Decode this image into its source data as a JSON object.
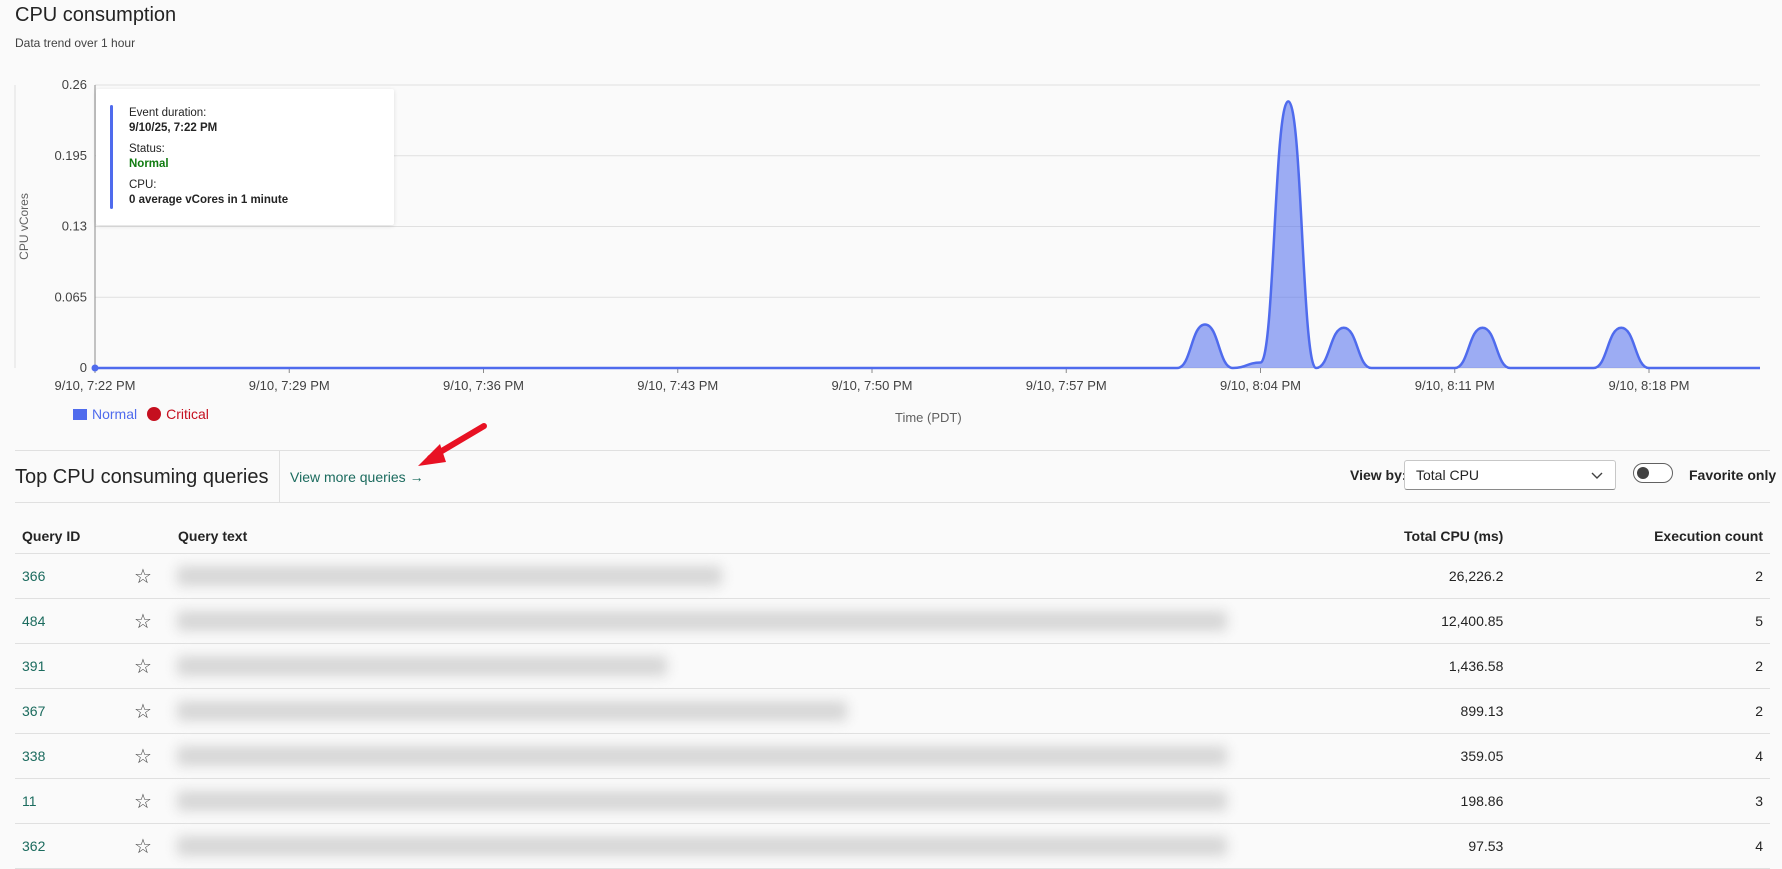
{
  "header": {
    "title": "CPU consumption",
    "subtitle": "Data trend over 1 hour"
  },
  "chart_data": {
    "type": "area",
    "ylabel": "CPU vCores",
    "xlabel": "Time (PDT)",
    "ylim": [
      0,
      0.26
    ],
    "yticks": [
      "0.26",
      "0.195",
      "0.13",
      "0.065",
      "0"
    ],
    "xticks": [
      "9/10, 7:22 PM",
      "9/10, 7:29 PM",
      "9/10, 7:36 PM",
      "9/10, 7:43 PM",
      "9/10, 7:50 PM",
      "9/10, 7:57 PM",
      "9/10, 8:04 PM",
      "9/10, 8:11 PM",
      "9/10, 8:18 PM"
    ],
    "grid": true,
    "legend": [
      {
        "name": "Normal",
        "color": "#4f6bed"
      },
      {
        "name": "Critical",
        "color": "#c50f1f"
      }
    ],
    "series": [
      {
        "name": "Normal",
        "points": [
          [
            0,
            0
          ],
          [
            39,
            0
          ],
          [
            40,
            0.04
          ],
          [
            41,
            0
          ],
          [
            42,
            0.005
          ],
          [
            43,
            0.245
          ],
          [
            44,
            0
          ],
          [
            45,
            0.037
          ],
          [
            46,
            0
          ],
          [
            49,
            0
          ],
          [
            50,
            0.037
          ],
          [
            51,
            0
          ],
          [
            54,
            0
          ],
          [
            55,
            0.037
          ],
          [
            56,
            0
          ],
          [
            60,
            0
          ]
        ]
      }
    ]
  },
  "tooltip": {
    "duration_label": "Event duration:",
    "duration_value": "9/10/25, 7:22 PM",
    "status_label": "Status:",
    "status_value": "Normal",
    "cpu_label": "CPU:",
    "cpu_value": "0 average vCores in 1 minute"
  },
  "queries": {
    "title": "Top CPU consuming queries",
    "view_more": "View more queries →",
    "view_by_label": "View by:",
    "view_by_value": "Total CPU",
    "favorite_label": "Favorite only",
    "columns": [
      "Query ID",
      "Query text",
      "Total CPU (ms)",
      "Execution count"
    ],
    "rows": [
      {
        "id": "366",
        "total_cpu": "26,226.2",
        "exec_count": "2"
      },
      {
        "id": "484",
        "total_cpu": "12,400.85",
        "exec_count": "5"
      },
      {
        "id": "391",
        "total_cpu": "1,436.58",
        "exec_count": "2"
      },
      {
        "id": "367",
        "total_cpu": "899.13",
        "exec_count": "2"
      },
      {
        "id": "338",
        "total_cpu": "359.05",
        "exec_count": "4"
      },
      {
        "id": "11",
        "total_cpu": "198.86",
        "exec_count": "3"
      },
      {
        "id": "362",
        "total_cpu": "97.53",
        "exec_count": "4"
      }
    ]
  },
  "icons": {
    "star": "star-icon",
    "chevron": "chevron-down-icon",
    "arrow": "arrow-annotation-icon"
  }
}
